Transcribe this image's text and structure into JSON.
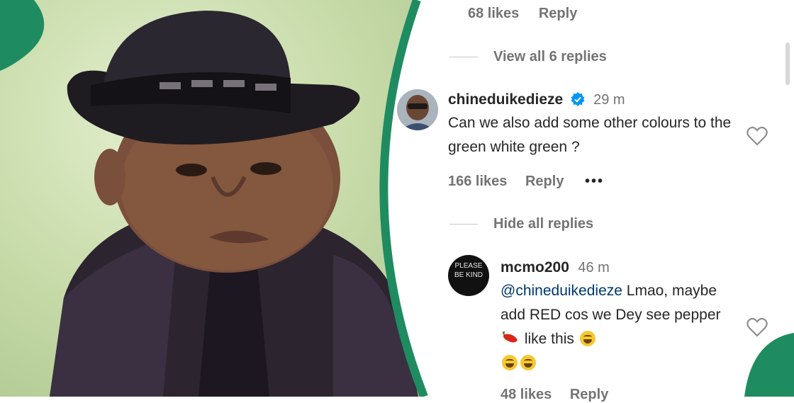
{
  "colors": {
    "accent_green": "#1e8c60",
    "verified_blue": "#0095f6",
    "text": "#262626",
    "muted": "#737373"
  },
  "top_row": {
    "likes": "68 likes",
    "reply": "Reply"
  },
  "thread1_toggle": "View all 6 replies",
  "comment1": {
    "username": "chineduikedieze",
    "time": "29 m",
    "text": "Can we also add some other colours to the green white green ?",
    "likes": "166 likes",
    "reply": "Reply",
    "more": "•••"
  },
  "thread2_toggle": "Hide all replies",
  "comment2": {
    "avatar_text": "PLEASE BE KIND",
    "username": "mcmo200",
    "time": "46 m",
    "mention": "@chineduikedieze",
    "text_part1": " Lmao, maybe add RED cos we Dey see pepper",
    "text_part2": " like this",
    "likes": "48 likes",
    "reply": "Reply"
  },
  "icons": {
    "heart": "heart-icon",
    "verified": "verified-badge-icon",
    "pepper": "chili-pepper-emoji",
    "laugh": "tears-of-joy-emoji"
  }
}
